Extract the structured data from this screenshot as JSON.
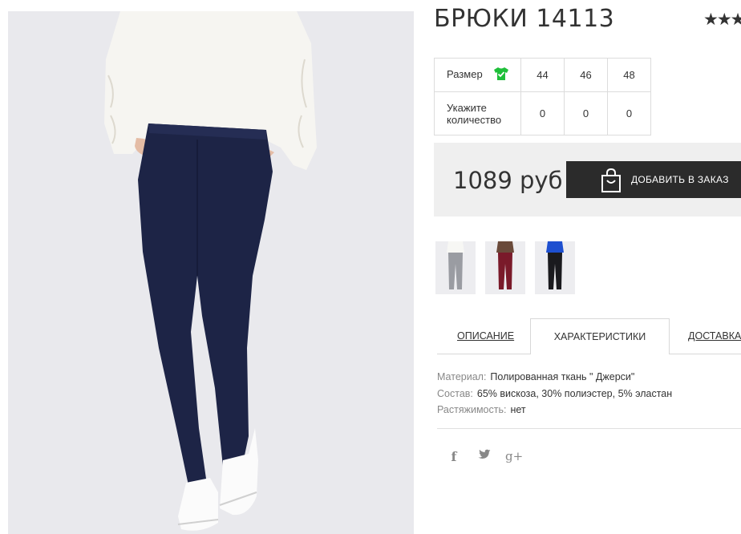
{
  "product": {
    "title": "БРЮКИ 14113",
    "rating_stars": "★★★"
  },
  "sizes": {
    "size_label": "Размер",
    "size_icon": "tshirt-check-icon",
    "values": [
      "44",
      "46",
      "48"
    ],
    "quantity_label_line1": "Укажите",
    "quantity_label_line2": "количество",
    "quantities": [
      "0",
      "0",
      "0"
    ]
  },
  "purchase": {
    "price": "1089 руб",
    "add_button": "ДОБАВИТЬ В ЗАКАЗ",
    "add_icon": "shopping-bag-icon"
  },
  "tabs": [
    {
      "label": "ОПИСАНИЕ",
      "active": false
    },
    {
      "label": "ХАРАКТЕРИСТИКИ",
      "active": true
    },
    {
      "label": "ДОСТАВКА",
      "active": false
    }
  ],
  "specs": [
    {
      "key": "Материал:",
      "value": "Полированная ткань \" Джерси\""
    },
    {
      "key": "Состав:",
      "value": "65% вискоза, 30% полиэстер, 5% эластан"
    },
    {
      "key": "Растяжимость:",
      "value": "нет"
    }
  ],
  "social": {
    "facebook": "f",
    "twitter_icon": "twitter-icon",
    "googleplus": "g+"
  },
  "colors": {
    "accent_green": "#1fbf3a",
    "button_dark": "#2b2b2b",
    "price_bg": "#efefef",
    "trousers_navy": "#1d2446"
  }
}
